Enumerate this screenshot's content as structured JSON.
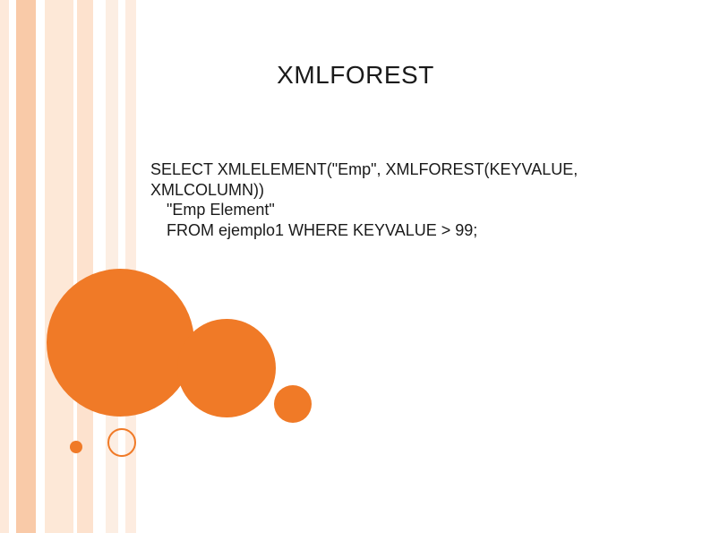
{
  "slide": {
    "title": "XMLFOREST",
    "code": {
      "line1": "SELECT XMLELEMENT(\"Emp\", XMLFOREST(KEYVALUE,",
      "line2": "XMLCOLUMN))",
      "line3": "\"Emp Element\"",
      "line4": "FROM ejemplo1 WHERE KEYVALUE > 99;"
    }
  }
}
